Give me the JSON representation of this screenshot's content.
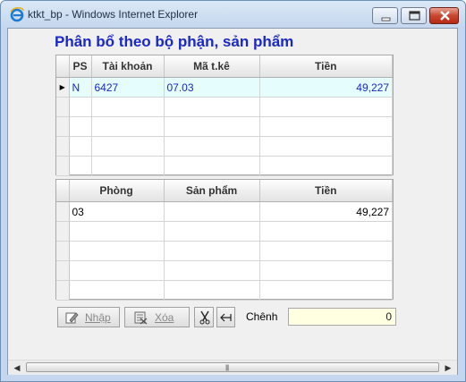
{
  "window": {
    "title": "ktkt_bp - Windows Internet Explorer"
  },
  "heading": "Phân bổ theo bộ phận, sản phẩm",
  "grid1": {
    "columns": [
      "PS",
      "Tài khoản",
      "Mã t.kê",
      "Tiền"
    ],
    "rows": [
      {
        "ps": "N",
        "account": "6427",
        "code": "07.03",
        "amount": "49,227"
      }
    ],
    "selected_indicator": "▶"
  },
  "grid2": {
    "columns": [
      "Phòng",
      "Sản phẩm",
      "Tiền"
    ],
    "rows": [
      {
        "room": "03",
        "product": "",
        "amount": "49,227"
      }
    ]
  },
  "toolbar": {
    "nhap_label": "Nhập",
    "xoa_label": "Xóa"
  },
  "chenh": {
    "label": "Chênh",
    "value": "0"
  },
  "icons": {
    "app": "internet-explorer-icon",
    "cut": "scissors-icon",
    "insert": "insert-row-icon"
  }
}
